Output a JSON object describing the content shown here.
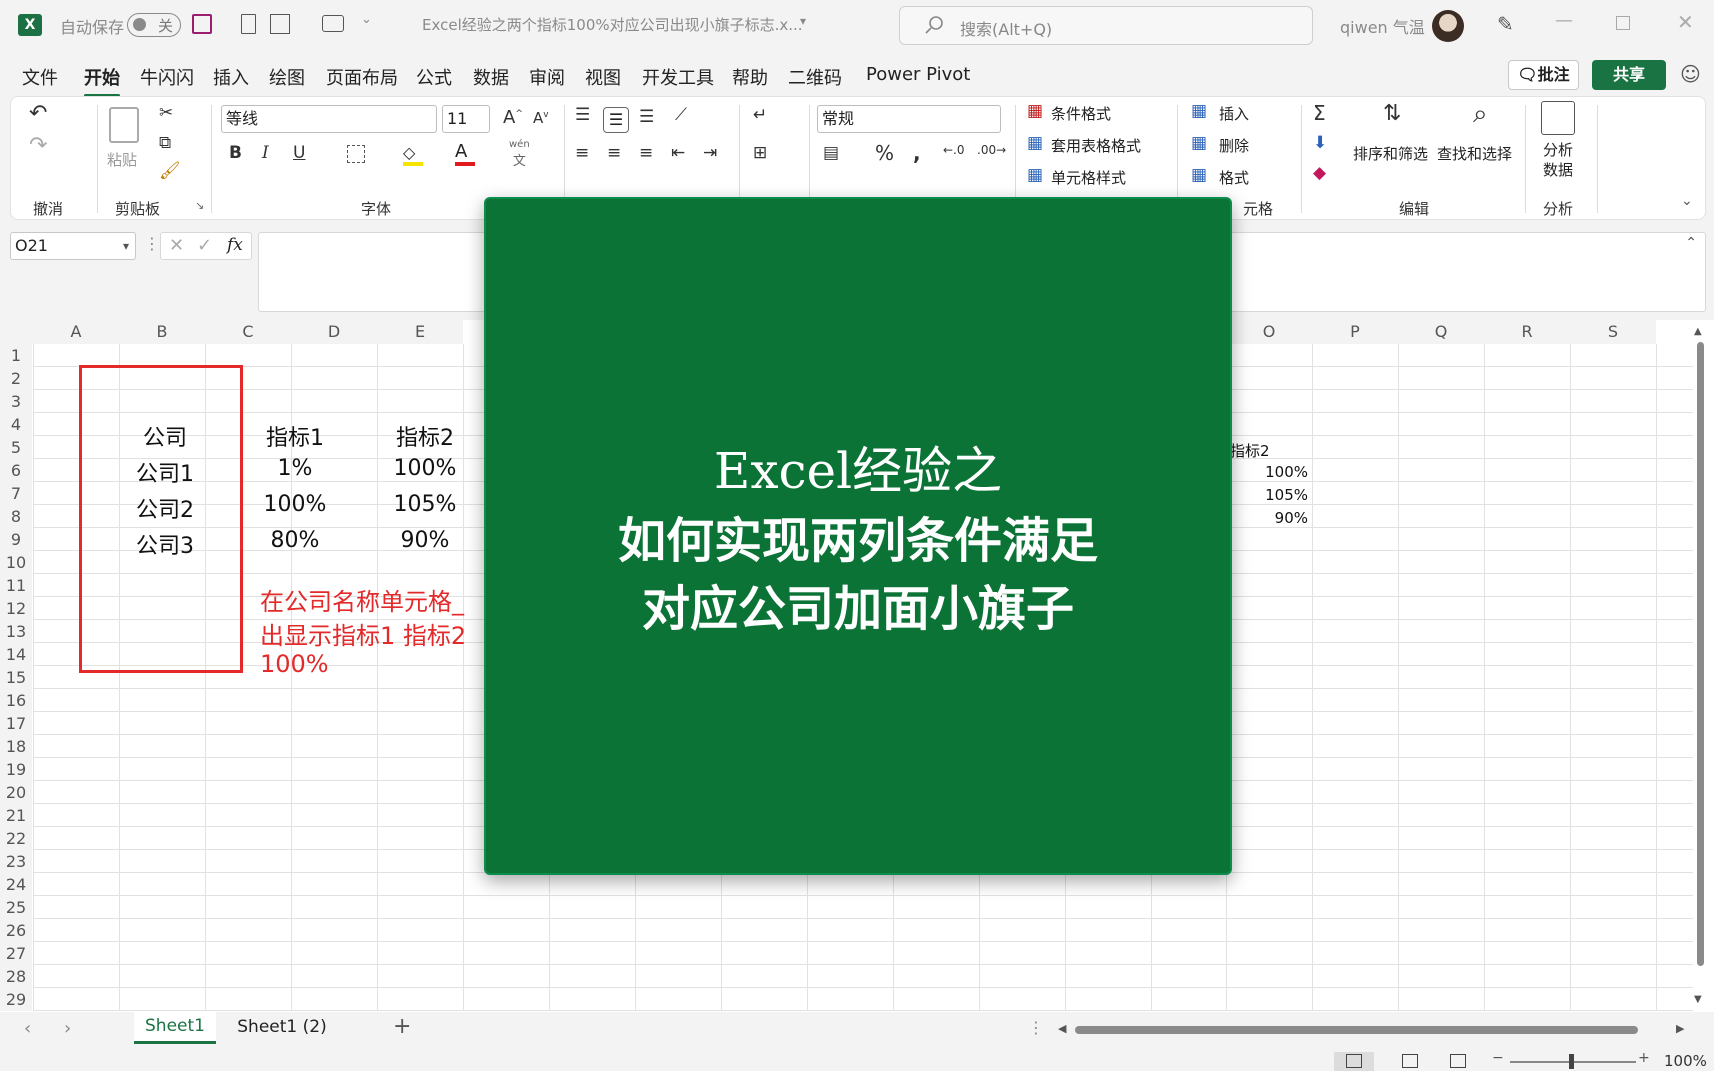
{
  "titlebar": {
    "autosave_label": "自动保存",
    "autosave_state": "关",
    "doc_title": "Excel经验之两个指标100%对应公司出现小旗子标志.x...",
    "search_placeholder": "搜索(Alt+Q)",
    "user_name": "qiwen 气温"
  },
  "menu": {
    "items": [
      "文件",
      "开始",
      "牛闪闪",
      "插入",
      "绘图",
      "页面布局",
      "公式",
      "数据",
      "审阅",
      "视图",
      "开发工具",
      "帮助",
      "二维码",
      "Power Pivot"
    ],
    "active_index": 1,
    "comment_label": "批注",
    "share_label": "共享"
  },
  "ribbon": {
    "groups": {
      "undo": "撤消",
      "clipboard": "剪贴板",
      "font": "字体",
      "cells": "元格",
      "editing": "编辑",
      "analysis": "分析"
    },
    "paste_label": "粘贴",
    "font_name": "等线",
    "font_size": "11",
    "number_format": "常规",
    "conditional_format": "条件格式",
    "format_as_table": "套用表格格式",
    "cell_styles": "单元格样式",
    "insert": "插入",
    "delete": "删除",
    "format": "格式",
    "sort_filter": "排序和筛选",
    "find_select": "查找和选择",
    "analyze_data_1": "分析",
    "analyze_data_2": "数据",
    "wen": "wén",
    "wen_char": "文"
  },
  "formula_bar": {
    "name_box": "O21",
    "fx": "fx"
  },
  "sheet": {
    "columns": [
      "A",
      "B",
      "C",
      "D",
      "E",
      "O",
      "P",
      "Q",
      "R",
      "S"
    ],
    "rows": [
      "1",
      "2",
      "3",
      "4",
      "5",
      "6",
      "7",
      "8",
      "9",
      "10",
      "11",
      "12",
      "13",
      "14",
      "15",
      "16",
      "17",
      "18",
      "19",
      "20",
      "21",
      "22",
      "23",
      "24",
      "25",
      "26",
      "27",
      "28",
      "29"
    ],
    "table_headers": [
      "公司",
      "指标1",
      "指标2"
    ],
    "table_rows": [
      [
        "公司1",
        "1%",
        "100%"
      ],
      [
        "公司2",
        "100%",
        "105%"
      ],
      [
        "公司3",
        "80%",
        "90%"
      ]
    ],
    "note_line1": "在公司名称单元格_",
    "note_line2": "出显示指标1  指标2",
    "note_line3": "100%",
    "right_header": "指标2",
    "right_values": [
      "100%",
      "105%",
      "90%"
    ]
  },
  "overlay": {
    "line1": "Excel经验之",
    "line2": "如何实现两列条件满足",
    "line3": "对应公司加面小旗子",
    "bg_color": "#0b7335"
  },
  "tabs": {
    "items": [
      "Sheet1",
      "Sheet1 (2)"
    ],
    "active_index": 0,
    "add_label": "+"
  },
  "status": {
    "zoom": "100%"
  },
  "colors": {
    "accent": "#1a7343",
    "red_box": "#e32929"
  }
}
